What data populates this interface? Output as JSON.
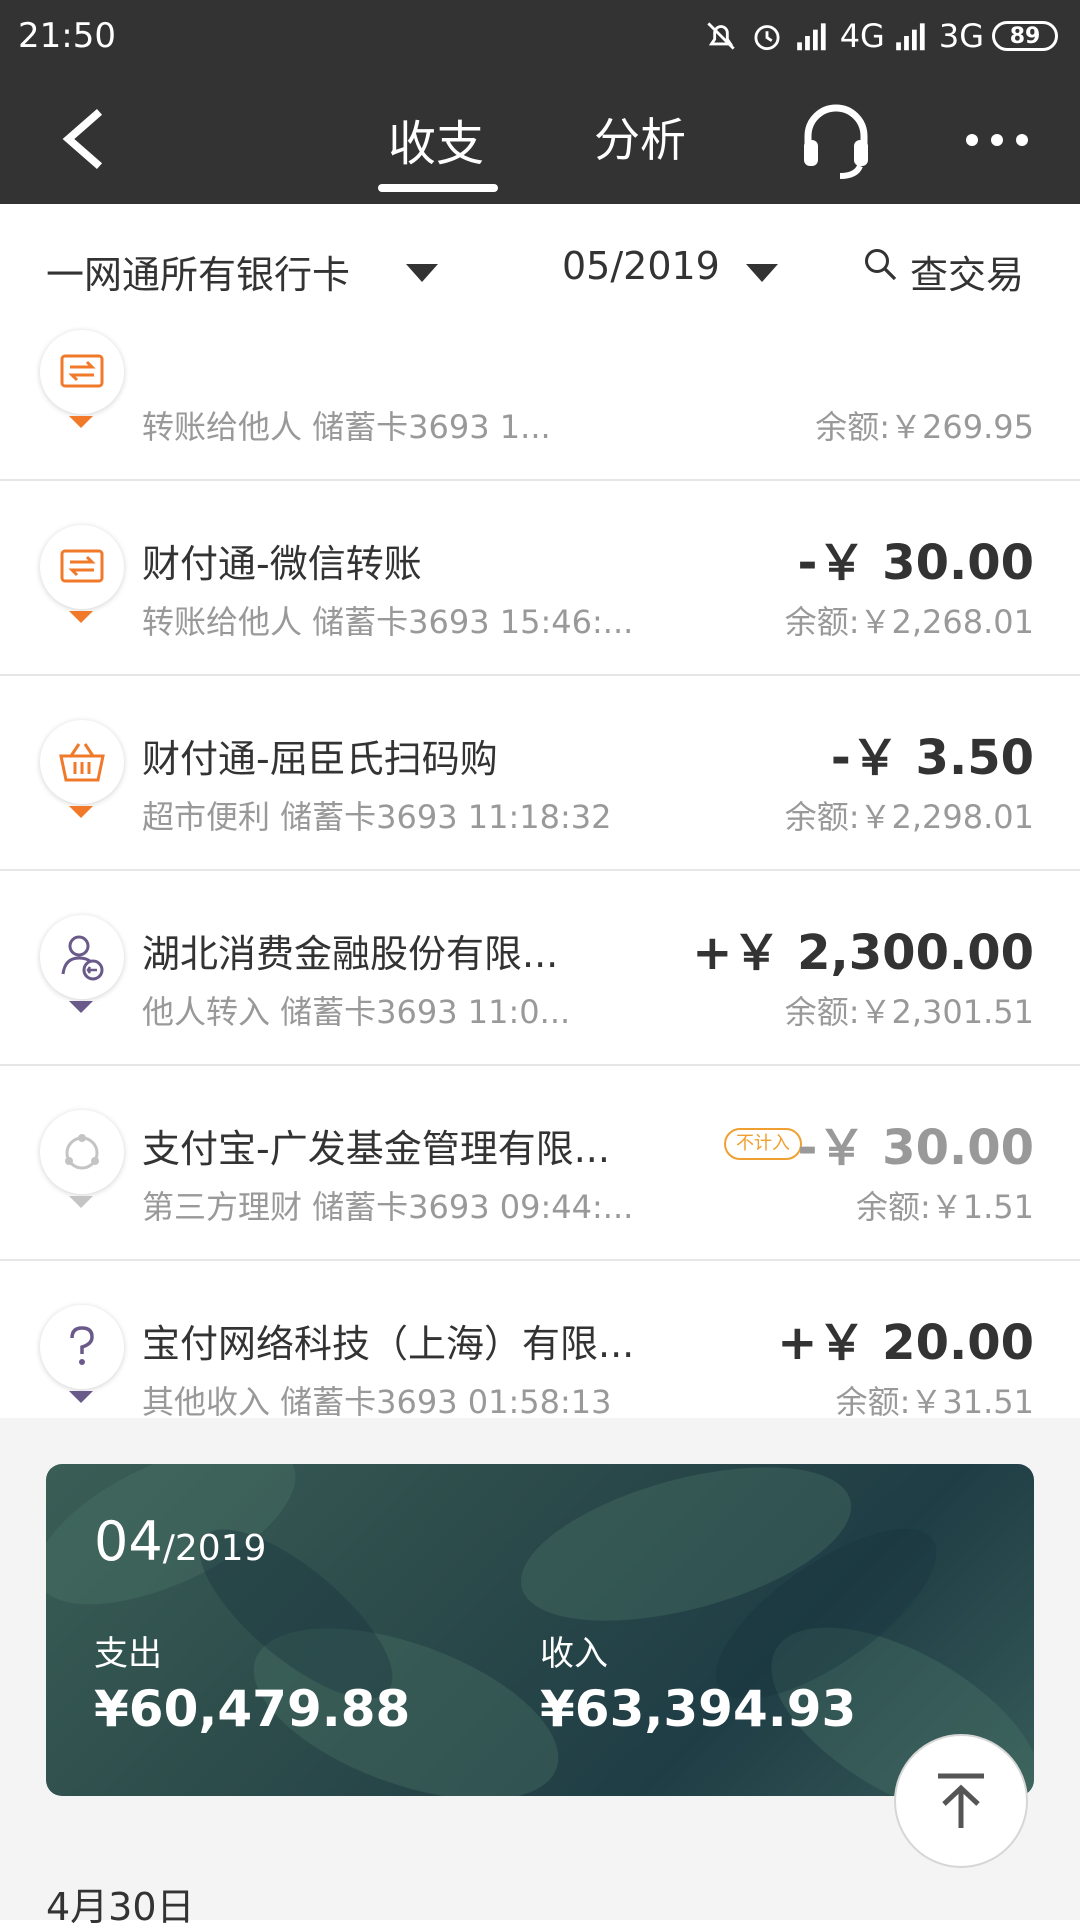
{
  "status_bar": {
    "time": "21:50",
    "network_1": "4G",
    "network_2": "3G",
    "battery": "89"
  },
  "nav": {
    "tab_active": "收支",
    "tab_other": "分析"
  },
  "filter": {
    "card": "一网通所有银行卡",
    "month": "05/2019",
    "search": "查交易"
  },
  "transactions": [
    {
      "title": "",
      "sub": "转账给他人  储蓄卡3693 1...",
      "amount": "",
      "balance": "余额:￥269.95",
      "icon": "transfer-icon"
    },
    {
      "title": "财付通-微信转账",
      "sub": "转账给他人  储蓄卡3693 15:46:...",
      "amount": "-￥ 30.00",
      "balance": "余额:￥2,268.01",
      "icon": "transfer-icon"
    },
    {
      "title": "财付通-屈臣氏扫码购",
      "sub": "超市便利  储蓄卡3693 11:18:32",
      "amount": "-￥ 3.50",
      "balance": "余额:￥2,298.01",
      "icon": "basket-icon"
    },
    {
      "title": "湖北消费金融股份有限...",
      "sub": "他人转入  储蓄卡3693 11:0...",
      "amount": "+￥ 2,300.00",
      "balance": "余额:￥2,301.51",
      "icon": "person-transfer-icon"
    },
    {
      "title": "支付宝-广发基金管理有限...",
      "sub": "第三方理财  储蓄卡3693 09:44:...",
      "amount": "-￥ 30.00",
      "balance": "余额:￥1.51",
      "badge": "不计入",
      "icon": "circle-nodes-icon"
    },
    {
      "title": "宝付网络科技（上海）有限...",
      "sub": "其他收入  储蓄卡3693 01:58:13",
      "amount": "+￥ 20.00",
      "balance": "余额:￥31.51",
      "icon": "question-icon"
    }
  ],
  "summary": {
    "month_big": "04",
    "month_small": "/2019",
    "expense_label": "支出",
    "expense_value": "¥60,479.88",
    "income_label": "收入",
    "income_value": "¥63,394.93"
  },
  "date_header": "4月30日",
  "colors": {
    "header_bg": "#333333",
    "accent_orange": "#f07a2a",
    "purple": "#6a5a8a"
  }
}
